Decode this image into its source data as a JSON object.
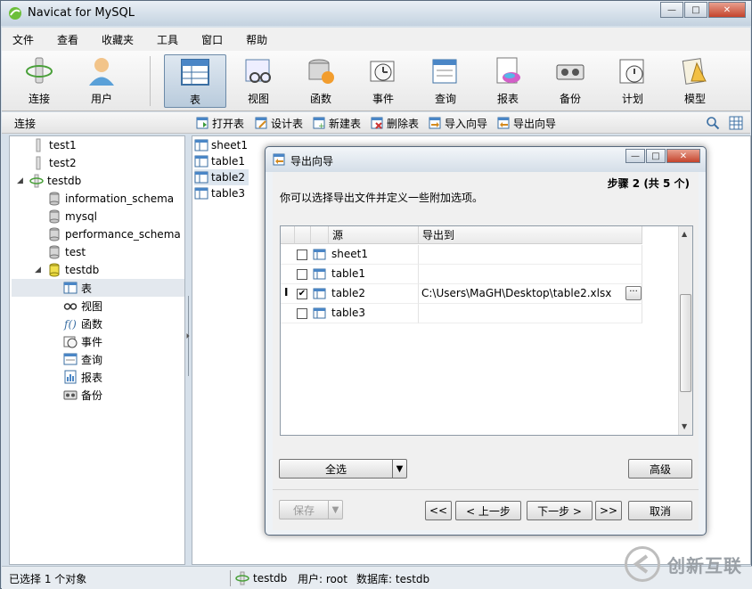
{
  "window": {
    "title": "Navicat for MySQL"
  },
  "menu": [
    "文件",
    "查看",
    "收藏夹",
    "工具",
    "窗口",
    "帮助"
  ],
  "toolbar": [
    {
      "label": "连接",
      "icon": "connection-icon"
    },
    {
      "label": "用户",
      "icon": "user-icon"
    },
    {
      "label": "表",
      "icon": "table-icon",
      "active": true
    },
    {
      "label": "视图",
      "icon": "view-icon"
    },
    {
      "label": "函数",
      "icon": "function-icon"
    },
    {
      "label": "事件",
      "icon": "event-icon"
    },
    {
      "label": "查询",
      "icon": "query-icon"
    },
    {
      "label": "报表",
      "icon": "report-icon"
    },
    {
      "label": "备份",
      "icon": "backup-icon"
    },
    {
      "label": "计划",
      "icon": "schedule-icon"
    },
    {
      "label": "模型",
      "icon": "model-icon"
    }
  ],
  "subbar": {
    "connection_label": "连接",
    "buttons": [
      "打开表",
      "设计表",
      "新建表",
      "删除表",
      "导入向导",
      "导出向导"
    ]
  },
  "tree": {
    "items": [
      {
        "label": "test1"
      },
      {
        "label": "test2"
      },
      {
        "label": "testdb"
      },
      {
        "label": "information_schema"
      },
      {
        "label": "mysql"
      },
      {
        "label": "performance_schema"
      },
      {
        "label": "test"
      },
      {
        "label": "testdb"
      },
      {
        "label": "表"
      },
      {
        "label": "视图"
      },
      {
        "label": "函数"
      },
      {
        "label": "事件"
      },
      {
        "label": "查询"
      },
      {
        "label": "报表"
      },
      {
        "label": "备份"
      }
    ]
  },
  "list": {
    "items": [
      "sheet1",
      "table1",
      "table2",
      "table3"
    ]
  },
  "status": {
    "selection": "已选择 1 个对象",
    "connection": "testdb",
    "user": "用户: root",
    "database": "数据库: testdb"
  },
  "watermark": {
    "text": "创新互联"
  },
  "dialog": {
    "title": "导出向导",
    "step": "步骤 2 (共 5 个)",
    "instruction": "你可以选择导出文件并定义一些附加选项。",
    "columns": {
      "source": "源",
      "export_to": "导出到"
    },
    "rows": [
      {
        "name": "sheet1",
        "checked": false,
        "path": ""
      },
      {
        "name": "table1",
        "checked": false,
        "path": ""
      },
      {
        "name": "table2",
        "checked": true,
        "path": "C:\\Users\\MaGH\\Desktop\\table2.xlsx"
      },
      {
        "name": "table3",
        "checked": false,
        "path": ""
      }
    ],
    "ellipsis": "···",
    "select_all": "全选",
    "advanced": "高级",
    "save": "保存",
    "first": "<<",
    "prev": "< 上一步",
    "next": "下一步 >",
    "last": ">>",
    "cancel": "取消"
  }
}
